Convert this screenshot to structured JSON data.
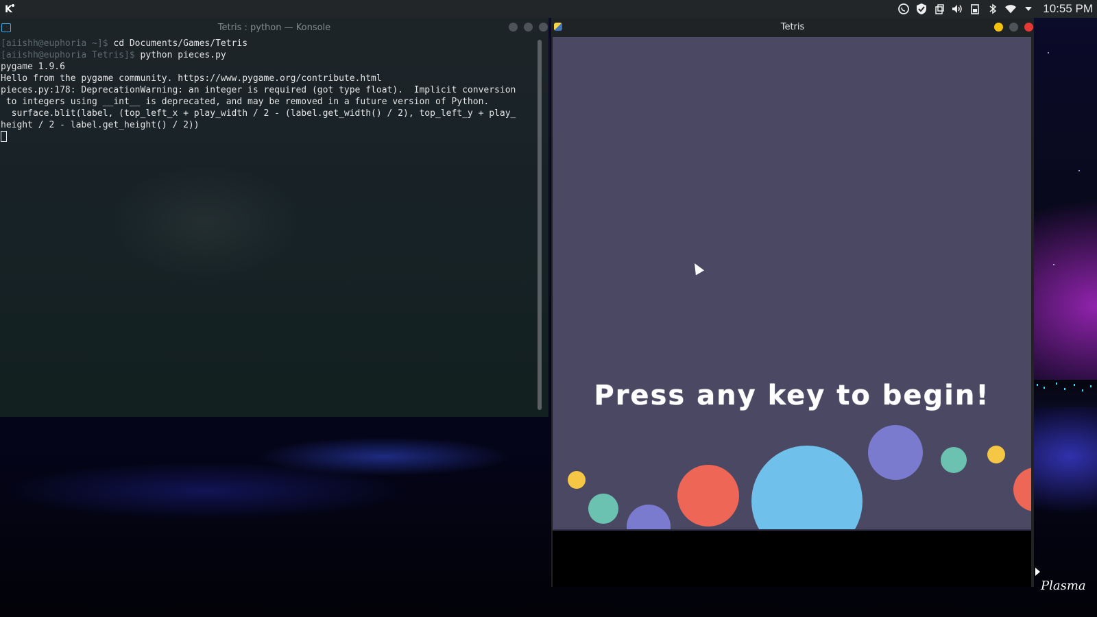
{
  "panel": {
    "clock": "10:55 PM",
    "tray_icons": [
      "whatsapp-icon",
      "shield-icon",
      "clipboard-icon",
      "volume-icon",
      "battery-icon",
      "bluetooth-icon",
      "wifi-icon",
      "expand-arrow-icon"
    ]
  },
  "konsole": {
    "title": "Tetris : python — Konsole",
    "lines": [
      {
        "prompt": "[aiishh@euphoria ~]$",
        "cmd": " cd Documents/Games/Tetris"
      },
      {
        "prompt": "[aiishh@euphoria Tetris]$",
        "cmd": " python pieces.py"
      }
    ],
    "output": [
      "pygame 1.9.6",
      "Hello from the pygame community. https://www.pygame.org/contribute.html",
      "pieces.py:178: DeprecationWarning: an integer is required (got type float).  Implicit conversion",
      " to integers using __int__ is deprecated, and may be removed in a future version of Python.",
      "  surface.blit(label, (top_left_x + play_width / 2 - (label.get_width() / 2), top_left_y + play_",
      "height / 2 - label.get_height() / 2))"
    ]
  },
  "tetris": {
    "title": "Tetris",
    "message": "Press any key to begin!",
    "colors": {
      "background": "#4a4862",
      "yellow": "#f5c744",
      "teal": "#6bc2b0",
      "purple": "#7a7bcf",
      "red": "#ee6656",
      "blue": "#6fc0ea",
      "minimize": "#f4c20d",
      "close": "#e53935"
    }
  },
  "desktop": {
    "branding": "Plasma"
  }
}
